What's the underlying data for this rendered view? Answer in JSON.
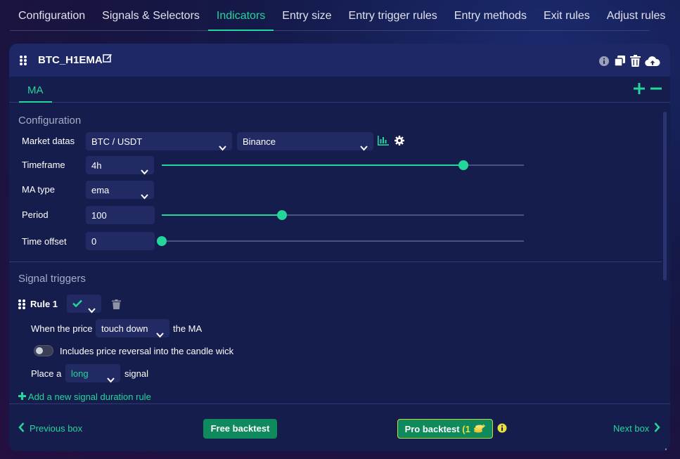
{
  "topnav": {
    "tabs": [
      {
        "label": "Configuration"
      },
      {
        "label": "Signals & Selectors"
      },
      {
        "label": "Indicators"
      },
      {
        "label": "Entry size"
      },
      {
        "label": "Entry trigger rules"
      },
      {
        "label": "Entry methods"
      },
      {
        "label": "Exit rules"
      },
      {
        "label": "Adjust rules"
      }
    ],
    "active_index": 2
  },
  "card": {
    "title": "BTC_H1EMA",
    "subtab": "MA",
    "configuration": {
      "section_title": "Configuration",
      "market_datas": {
        "label": "Market datas",
        "pair": "BTC / USDT",
        "exchange": "Binance"
      },
      "timeframe": {
        "label": "Timeframe",
        "value": "4h",
        "slider_fraction": 0.83
      },
      "ma_type": {
        "label": "MA type",
        "value": "ema"
      },
      "period": {
        "label": "Period",
        "value": "100",
        "slider_fraction": 0.33
      },
      "time_offset": {
        "label": "Time offset",
        "value": "0",
        "slider_fraction": 0.0
      }
    },
    "signal_triggers": {
      "section_title": "Signal triggers",
      "rule_label": "Rule 1",
      "when_prefix": "When the price",
      "when_value": "touch down",
      "when_suffix": "the MA",
      "toggle_label": "Includes price reversal into the candle wick",
      "place_prefix": "Place a",
      "place_value": "long",
      "place_suffix": "signal",
      "add_rule": "Add a new signal duration rule"
    },
    "footer": {
      "previous": "Previous box",
      "free_backtest": "Free backtest",
      "pro_backtest": "Pro backtest",
      "pro_count": "(1",
      "next": "Next box"
    }
  },
  "colors": {
    "accent": "#23d69a",
    "card_bg": "#151d4d",
    "header_bg": "#1e2866",
    "input_bg": "#212a63"
  }
}
